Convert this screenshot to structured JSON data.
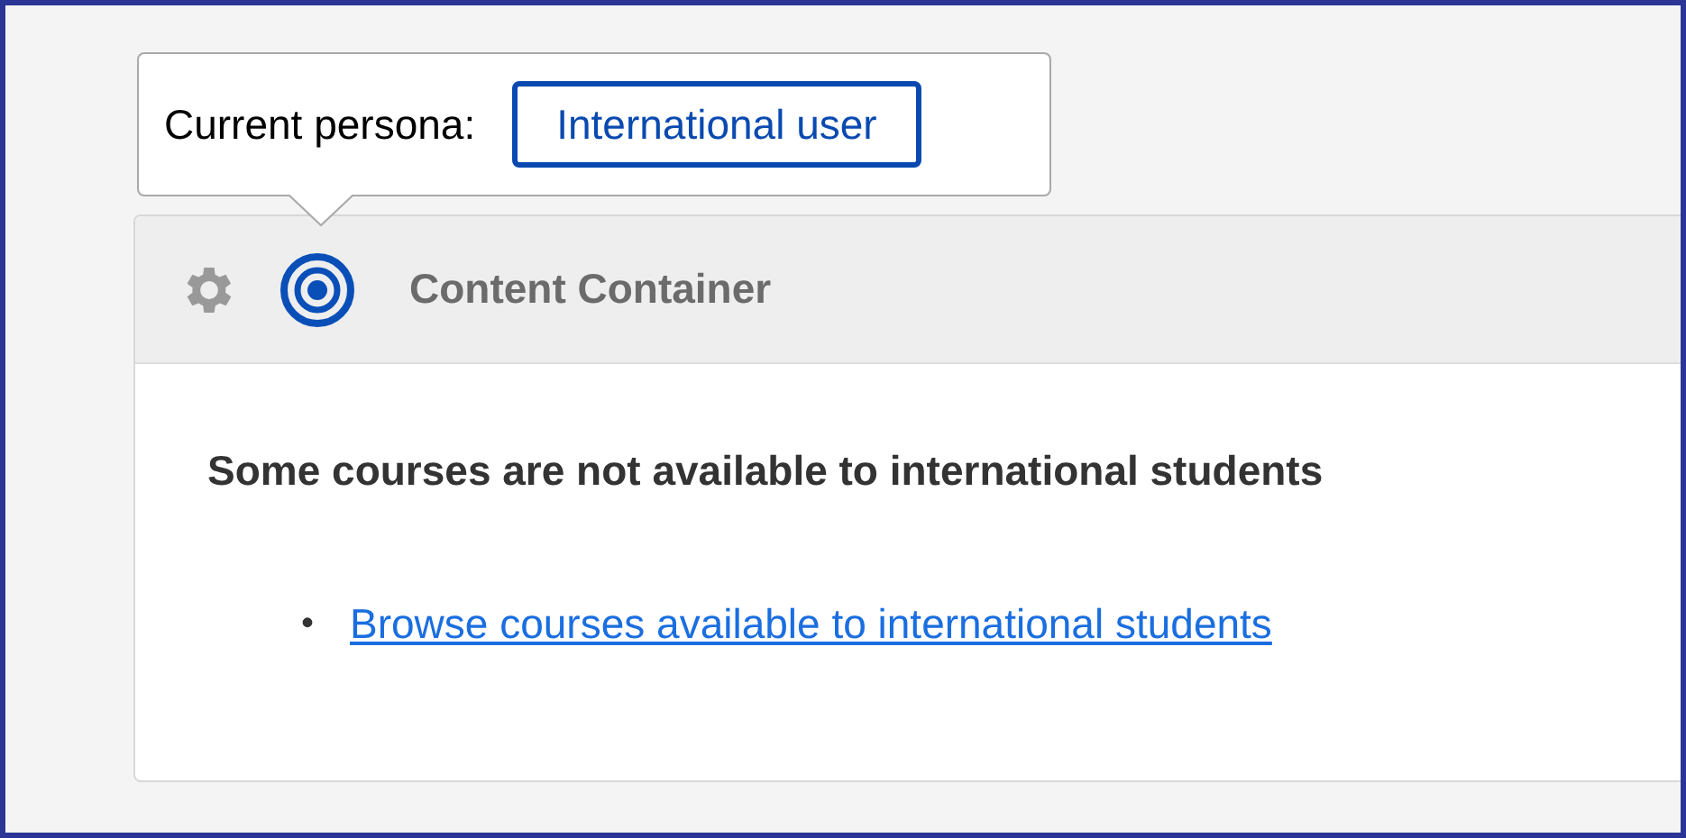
{
  "persona_popover": {
    "label": "Current persona:",
    "button": "International user"
  },
  "container": {
    "title": "Content Container",
    "heading": "Some courses are not available to international students",
    "links": [
      {
        "bullet": "•",
        "text": "Browse courses available to international students"
      }
    ]
  }
}
